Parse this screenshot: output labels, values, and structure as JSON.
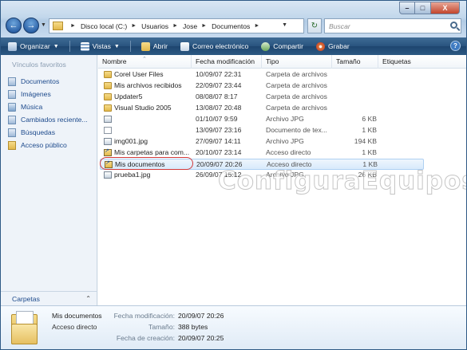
{
  "window": {
    "caption_buttons": {
      "minimize": "–",
      "maximize": "□",
      "close": "X"
    }
  },
  "address": {
    "segments": [
      "Disco local (C:)",
      "Usuarios",
      "Jose",
      "Documentos"
    ],
    "search_placeholder": "Buscar"
  },
  "toolbar": {
    "items": [
      {
        "label": "Organizar",
        "icon": "organize-icon",
        "dropdown": true
      },
      {
        "label": "Vistas",
        "icon": "views-icon",
        "dropdown": true
      },
      {
        "label": "Abrir",
        "icon": "open-icon"
      },
      {
        "label": "Correo electrónico",
        "icon": "email-icon"
      },
      {
        "label": "Compartir",
        "icon": "share-icon"
      },
      {
        "label": "Grabar",
        "icon": "burn-icon"
      }
    ],
    "help": "?"
  },
  "nav": {
    "heading": "Vínculos favoritos",
    "items": [
      {
        "label": "Documentos",
        "icon": "documents-icon"
      },
      {
        "label": "Imágenes",
        "icon": "pictures-icon"
      },
      {
        "label": "Música",
        "icon": "music-icon"
      },
      {
        "label": "Cambiados reciente...",
        "icon": "recent-icon"
      },
      {
        "label": "Búsquedas",
        "icon": "searches-icon"
      },
      {
        "label": "Acceso público",
        "icon": "public-folder-icon"
      }
    ],
    "folders_label": "Carpetas"
  },
  "columns": [
    "Nombre",
    "Fecha modificación",
    "Tipo",
    "Tamaño",
    "Etiquetas"
  ],
  "files": [
    {
      "name": "Corel User Files",
      "date": "10/09/07 22:31",
      "type": "Carpeta de archivos",
      "size": "",
      "icon": "folder"
    },
    {
      "name": "Mis archivos recibidos",
      "date": "22/09/07 23:44",
      "type": "Carpeta de archivos",
      "size": "",
      "icon": "folder"
    },
    {
      "name": "Updater5",
      "date": "08/08/07 8:17",
      "type": "Carpeta de archivos",
      "size": "",
      "icon": "folder"
    },
    {
      "name": "Visual Studio 2005",
      "date": "13/08/07 20:48",
      "type": "Carpeta de archivos",
      "size": "",
      "icon": "folder"
    },
    {
      "name": "",
      "date": "01/10/07 9:59",
      "type": "Archivo JPG",
      "size": "6 KB",
      "icon": "jpg"
    },
    {
      "name": "",
      "date": "13/09/07 23:16",
      "type": "Documento de tex...",
      "size": "1 KB",
      "icon": "doc"
    },
    {
      "name": "img001.jpg",
      "date": "27/09/07 14:11",
      "type": "Archivo JPG",
      "size": "194 KB",
      "icon": "jpg"
    },
    {
      "name": "Mis carpetas para com...",
      "date": "20/10/07 23:14",
      "type": "Acceso directo",
      "size": "1 KB",
      "icon": "lnk"
    },
    {
      "name": "Mis documentos",
      "date": "20/09/07 20:26",
      "type": "Acceso directo",
      "size": "1 KB",
      "icon": "lnk",
      "selected": true
    },
    {
      "name": "prueba1.jpg",
      "date": "26/09/07 15:12",
      "type": "Archivo JPG",
      "size": "26 KB",
      "icon": "jpg"
    }
  ],
  "watermark": "ConfiguraEquipos",
  "details": {
    "name": "Mis documentos",
    "kind": "Acceso directo",
    "fields": [
      {
        "label": "Fecha modificación:",
        "value": "20/09/07 20:26"
      },
      {
        "label": "Tamaño:",
        "value": "388 bytes"
      },
      {
        "label": "Fecha de creación:",
        "value": "20/09/07 20:25"
      }
    ]
  }
}
